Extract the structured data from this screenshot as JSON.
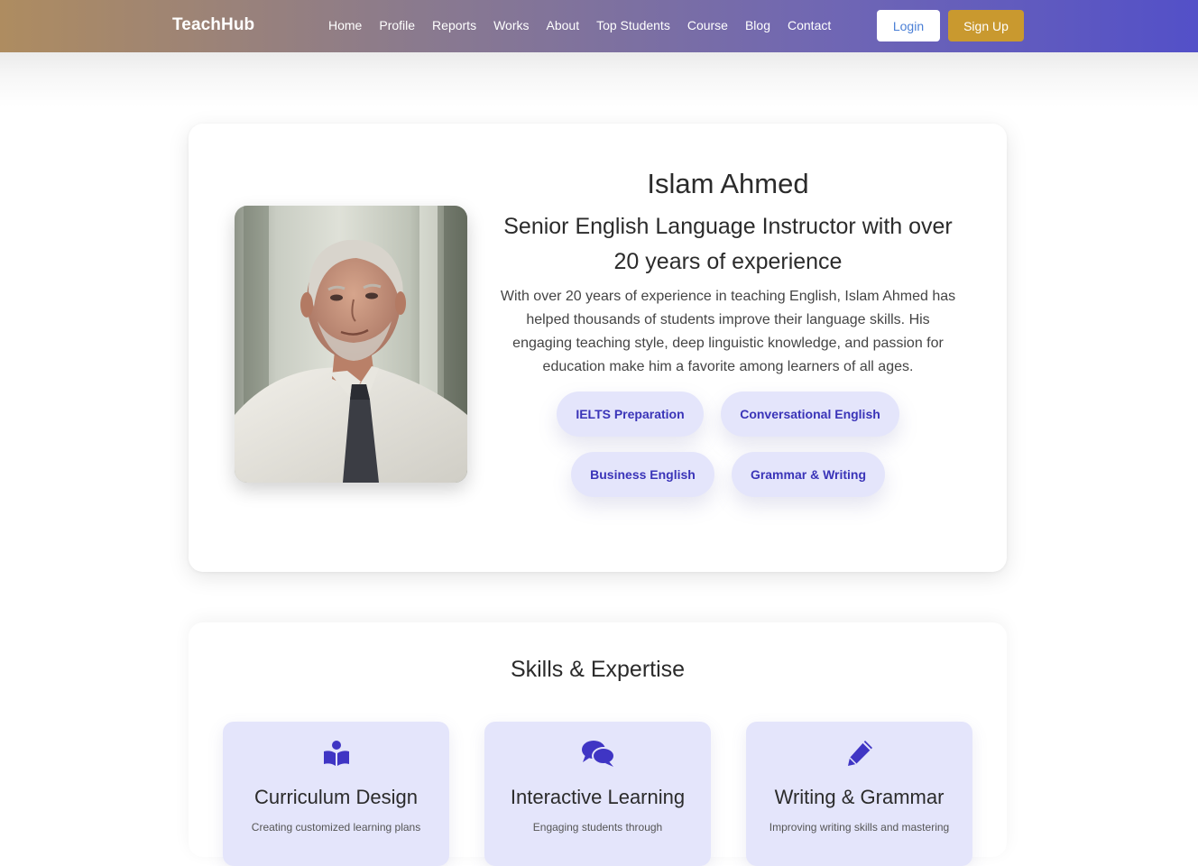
{
  "navbar": {
    "brand": "TeachHub",
    "links": [
      "Home",
      "Profile",
      "Reports",
      "Works",
      "About",
      "Top Students",
      "Course",
      "Blog",
      "Contact"
    ],
    "login_label": "Login",
    "signup_label": "Sign Up"
  },
  "profile": {
    "name": "Islam Ahmed",
    "headline": "Senior English Language Instructor with over 20 years of experience",
    "bio": "With over 20 years of experience in teaching English, Islam Ahmed has helped thousands of students improve their language skills. His engaging teaching style, deep linguistic knowledge, and passion for education make him a favorite among learners of all ages.",
    "tags": [
      "IELTS Preparation",
      "Conversational English",
      "Business English",
      "Grammar & Writing"
    ]
  },
  "skills": {
    "title": "Skills & Expertise",
    "cards": [
      {
        "icon": "book-reader-icon",
        "name": "Curriculum Design",
        "desc": "Creating customized learning plans"
      },
      {
        "icon": "comments-icon",
        "name": "Interactive Learning",
        "desc": "Engaging students through"
      },
      {
        "icon": "pencil-icon",
        "name": "Writing & Grammar",
        "desc": "Improving writing skills and mastering"
      }
    ]
  },
  "colors": {
    "accent": "#5350c8",
    "gold": "#c9992f",
    "tag_bg": "#e4e5fb",
    "tag_text": "#3a34b8",
    "icon": "#3f35c4"
  }
}
